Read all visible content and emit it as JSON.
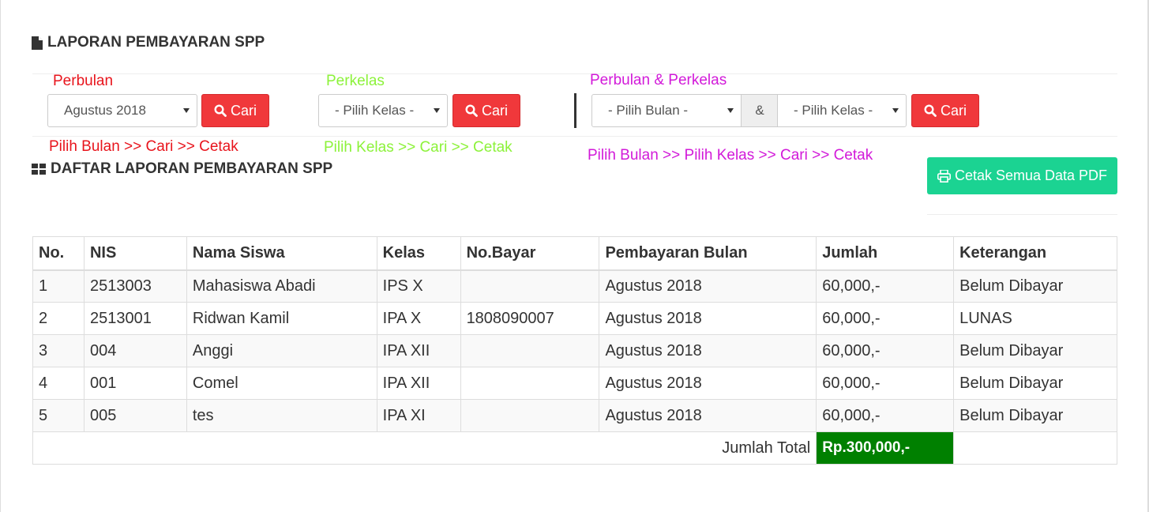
{
  "page_title": "LAPORAN PEMBAYARAN SPP",
  "filters": {
    "perbulan": {
      "label": "Perbulan",
      "label_color": "#e8141c",
      "month_select": "Agustus 2018",
      "button": "Cari",
      "hint": "Pilih Bulan >> Cari >> Cetak"
    },
    "perkelas": {
      "label": "Perkelas",
      "label_color": "#8cf23a",
      "class_select": "- Pilih Kelas -",
      "button": "Cari",
      "hint": "Pilih Kelas >> Cari >> Cetak"
    },
    "perbulan_perkelas": {
      "label": "Perbulan & Perkelas",
      "label_color": "#d21ad9",
      "month_select": "- Pilih Bulan -",
      "amp": "&",
      "class_select": "- Pilih Kelas -",
      "button": "Cari",
      "hint": "Pilih Bulan >> Pilih Kelas >> Cari >> Cetak"
    }
  },
  "section_title": "DAFTAR LAPORAN PEMBAYARAN SPP",
  "print_button": "Cetak Semua Data PDF",
  "table": {
    "headers": [
      "No.",
      "NIS",
      "Nama Siswa",
      "Kelas",
      "No.Bayar",
      "Pembayaran Bulan",
      "Jumlah",
      "Keterangan"
    ],
    "rows": [
      [
        "1",
        "2513003",
        "Mahasiswa Abadi",
        "IPS X",
        "",
        "Agustus 2018",
        "60,000,-",
        "Belum Dibayar"
      ],
      [
        "2",
        "2513001",
        "Ridwan Kamil",
        "IPA X",
        "1808090007",
        "Agustus 2018",
        "60,000,-",
        "LUNAS"
      ],
      [
        "3",
        "004",
        "Anggi",
        "IPA XII",
        "",
        "Agustus 2018",
        "60,000,-",
        "Belum Dibayar"
      ],
      [
        "4",
        "001",
        "Comel",
        "IPA XII",
        "",
        "Agustus 2018",
        "60,000,-",
        "Belum Dibayar"
      ],
      [
        "5",
        "005",
        "tes",
        "IPA XI",
        "",
        "Agustus 2018",
        "60,000,-",
        "Belum Dibayar"
      ]
    ],
    "total_label": "Jumlah Total",
    "total_value": "Rp.300,000,-"
  },
  "colors": {
    "cari_button": "#f0383b",
    "pdf_button": "#1bd392",
    "total_cell": "#008000"
  }
}
